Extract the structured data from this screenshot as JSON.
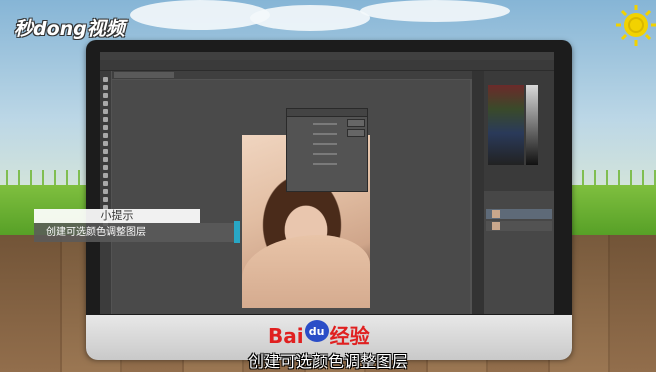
{
  "watermark": {
    "logo_text": "秒dong视频"
  },
  "tip": {
    "title": "小提示",
    "body": "创建可选颜色调整图层"
  },
  "brand": {
    "part1": "Bai",
    "du": "du",
    "part2": "经验"
  },
  "caption": "创建可选颜色调整图层",
  "colors": {
    "tip_accent": "#28a7c5",
    "brand_red": "#e02020",
    "brand_blue": "#2a4dc7"
  },
  "icons": [
    "sun-icon",
    "photoshop-tools",
    "eye-icon"
  ]
}
